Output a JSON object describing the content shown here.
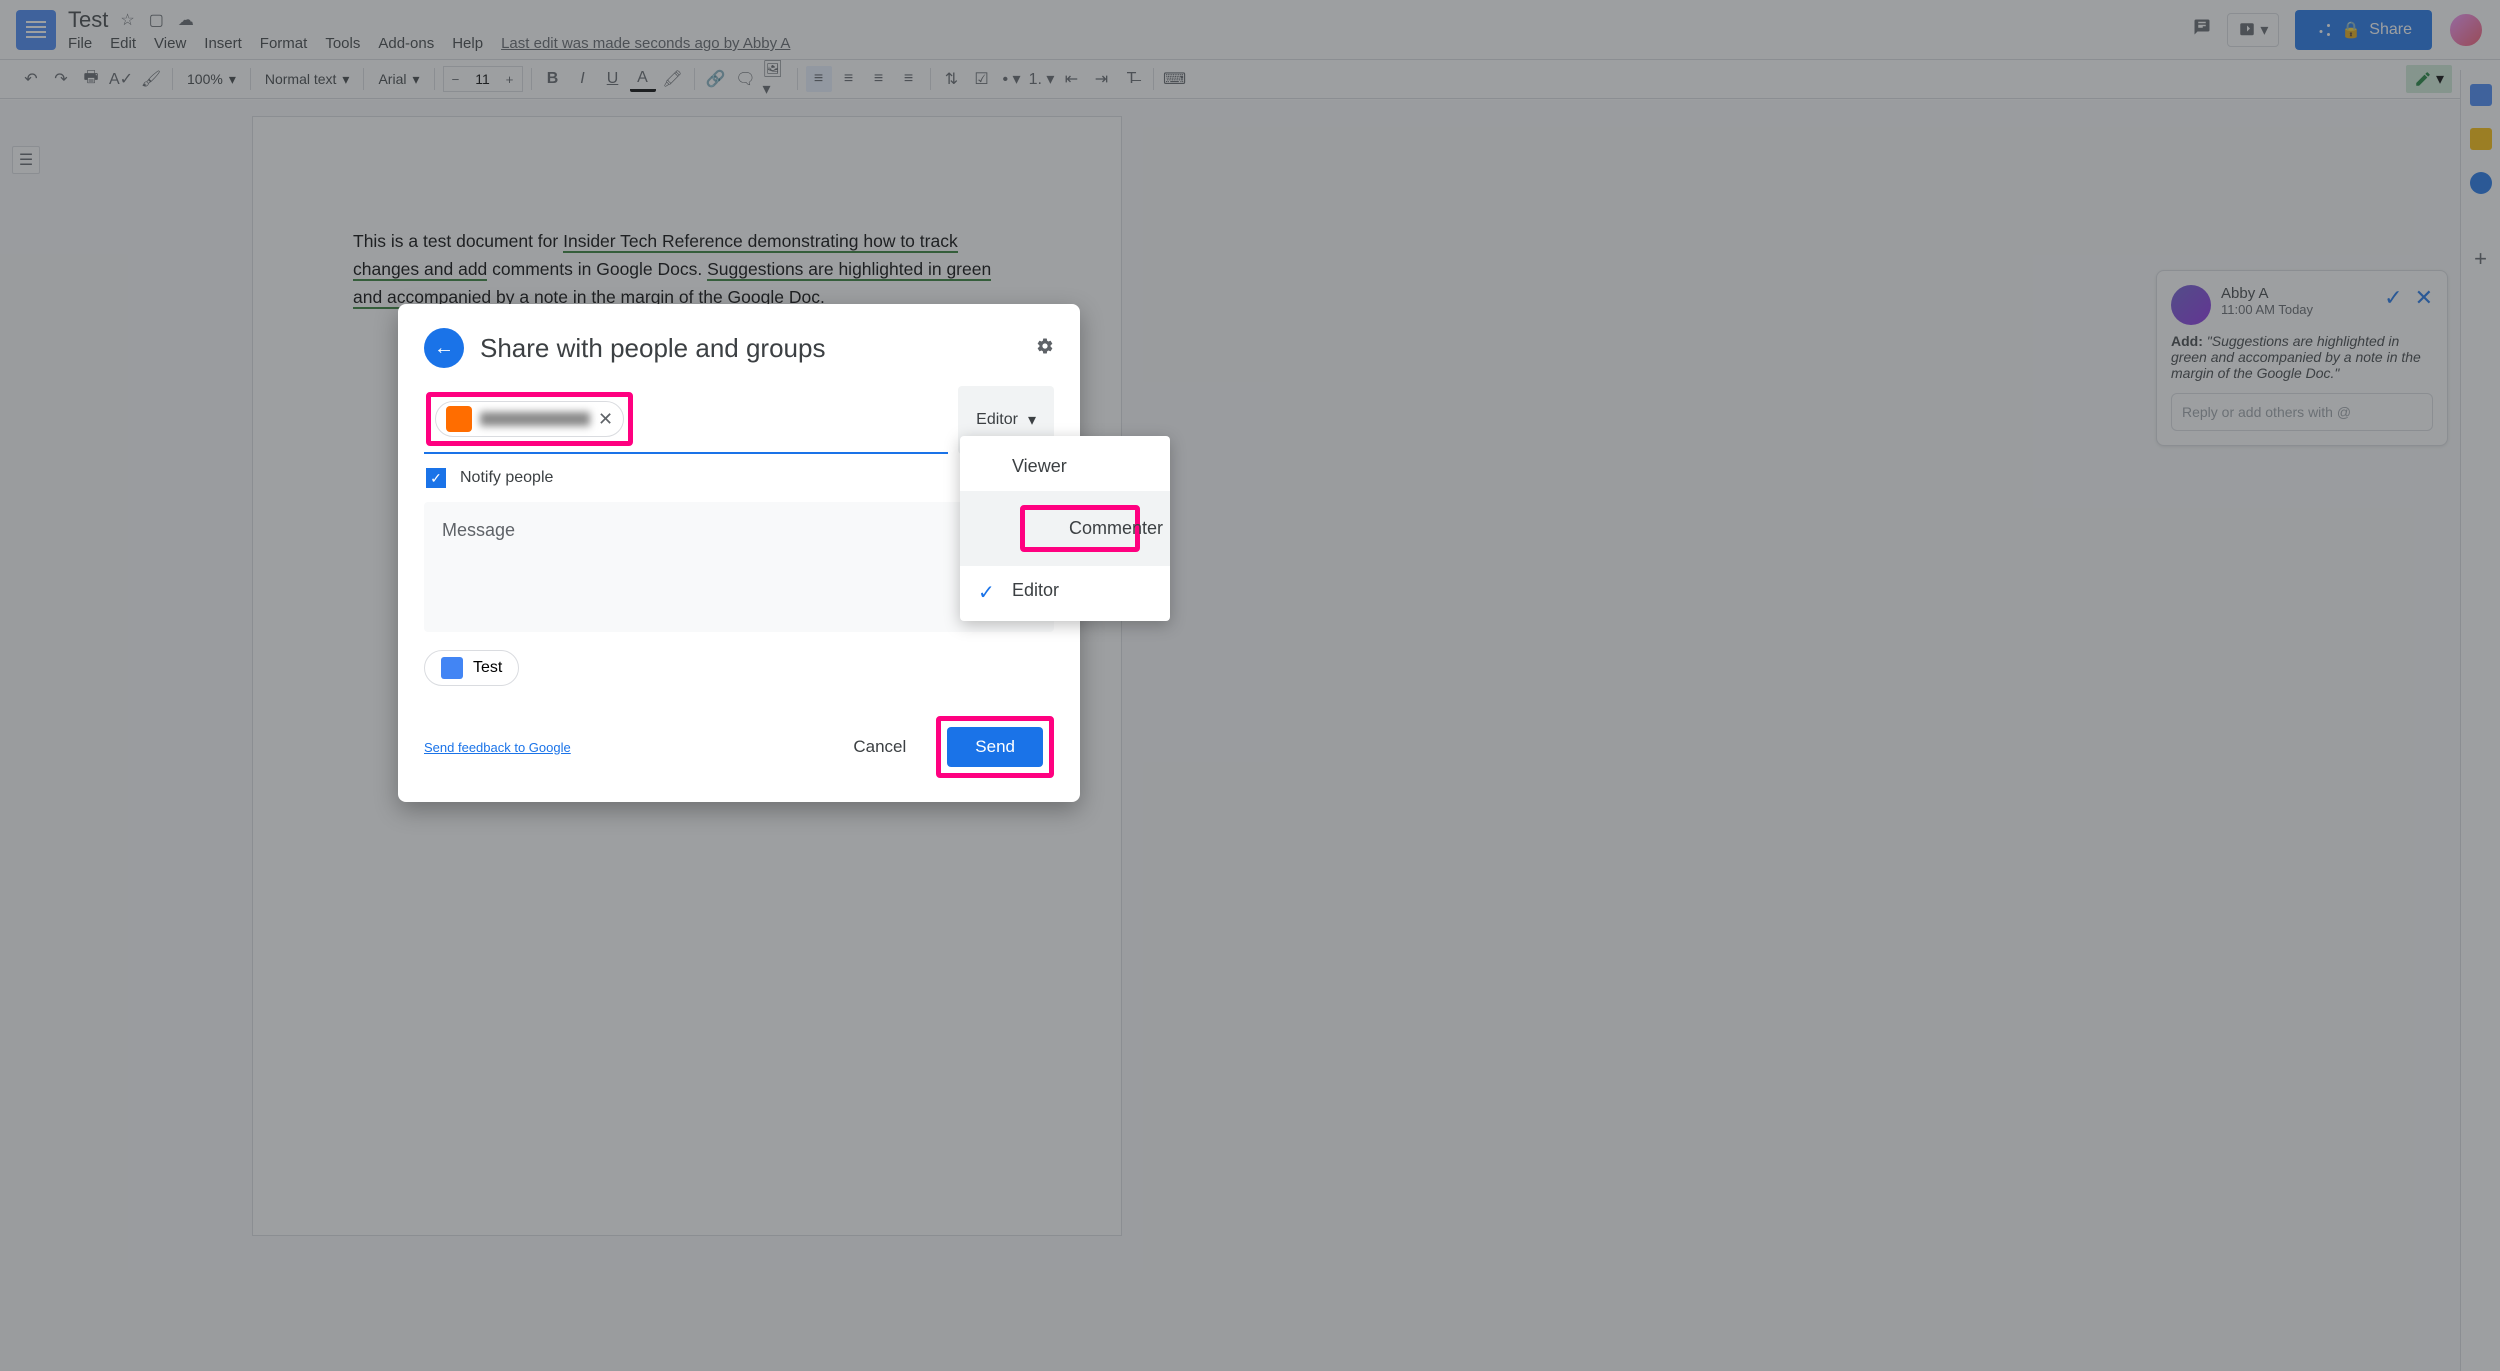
{
  "header": {
    "title": "Test",
    "menus": [
      "File",
      "Edit",
      "View",
      "Insert",
      "Format",
      "Tools",
      "Add-ons",
      "Help"
    ],
    "last_edit": "Last edit was made seconds ago by Abby A",
    "share_label": "Share"
  },
  "toolbar": {
    "zoom": "100%",
    "style": "Normal text",
    "font": "Arial",
    "font_size": "11"
  },
  "document": {
    "text_before": "This is a test document for ",
    "suggestion1": "Insider Tech Reference demonstrating how to track changes and add",
    "text_mid": " comments in Google Docs. ",
    "suggestion2": "Suggestions are highlighted in green and accompanied by a note in the margin of the Google Doc."
  },
  "comment": {
    "author": "Abby A",
    "time": "11:00 AM Today",
    "add_label": "Add:",
    "quote": "\"Suggestions are highlighted in green and accompanied by a note in the margin of the Google Doc.\"",
    "reply_placeholder": "Reply or add others with @"
  },
  "dialog": {
    "title": "Share with people and groups",
    "role_label": "Editor",
    "notify_label": "Notify people",
    "message_placeholder": "Message",
    "doc_chip": "Test",
    "feedback": "Send feedback to Google",
    "cancel": "Cancel",
    "send": "Send",
    "roles": {
      "viewer": "Viewer",
      "commenter": "Commenter",
      "editor": "Editor"
    }
  }
}
